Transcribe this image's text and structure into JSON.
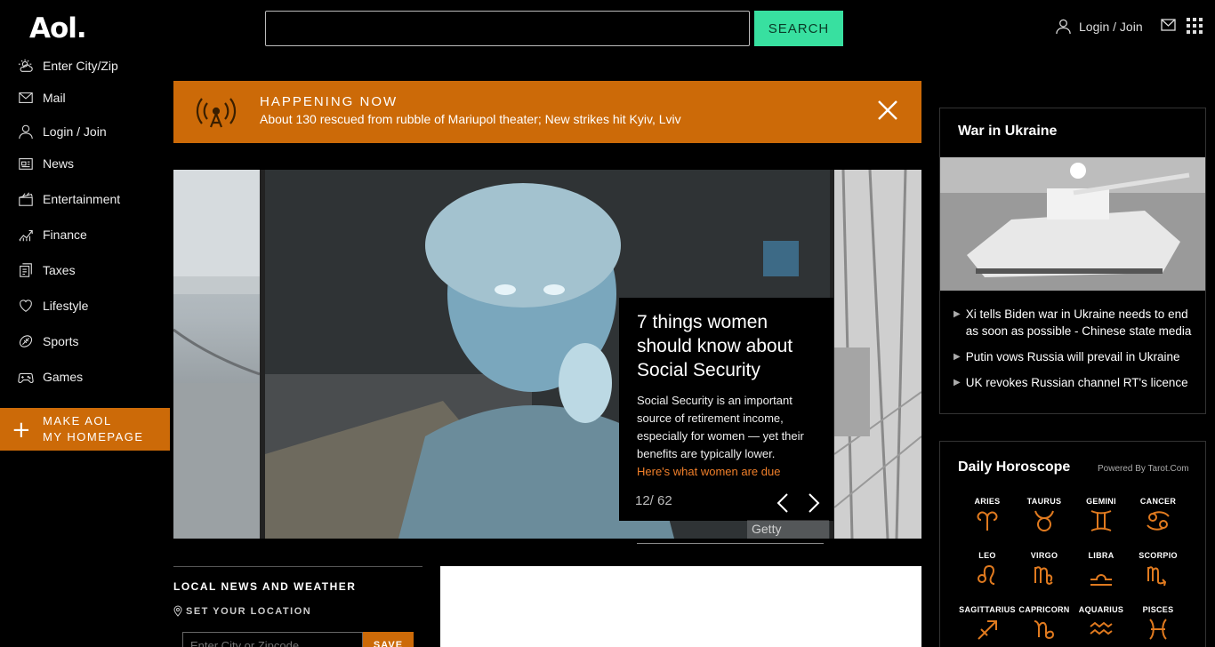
{
  "header": {
    "logo": "Aol.",
    "search_placeholder": "",
    "search_button": "SEARCH",
    "login_label": "Login / Join"
  },
  "sidebar": {
    "items": [
      {
        "label": "Enter City/Zip",
        "icon": "weather-icon"
      },
      {
        "label": "Mail",
        "icon": "mail-icon"
      },
      {
        "label": "Login / Join",
        "icon": "user-icon"
      },
      {
        "label": "News",
        "icon": "news-icon"
      },
      {
        "label": "Entertainment",
        "icon": "clapper-icon"
      },
      {
        "label": "Finance",
        "icon": "chart-icon"
      },
      {
        "label": "Taxes",
        "icon": "document-icon"
      },
      {
        "label": "Lifestyle",
        "icon": "heart-icon"
      },
      {
        "label": "Sports",
        "icon": "ball-icon"
      },
      {
        "label": "Games",
        "icon": "gamepad-icon"
      }
    ],
    "homepage_line1": "MAKE AOL",
    "homepage_line2": "MY HOMEPAGE"
  },
  "breaking": {
    "title": "HAPPENING NOW",
    "text": "About 130 rescued from rubble of Mariupol theater; New strikes hit Kyiv, Lviv"
  },
  "carousel": {
    "headline": "7 things women should know about Social Security",
    "summary": "Social Security is an important source of retirement income, especially for women — yet their benefits are typically lower.",
    "link": "Here's what women are due",
    "counter": "12/ 62",
    "credit": "Getty Images"
  },
  "local": {
    "title": "LOCAL NEWS AND WEATHER",
    "subtitle": "SET YOUR LOCATION",
    "input_placeholder": "Enter City or Zipcode",
    "save_label": "SAVE"
  },
  "ukraine": {
    "title": "War in Ukraine",
    "items": [
      "Xi tells Biden war in Ukraine needs to end as soon as possible - Chinese state media",
      "Putin vows Russia will prevail in Ukraine",
      "UK revokes Russian channel RT's licence"
    ]
  },
  "horoscope": {
    "title": "Daily Horoscope",
    "powered": "Powered By Tarot.Com",
    "signs": [
      "ARIES",
      "TAURUS",
      "GEMINI",
      "CANCER",
      "LEO",
      "VIRGO",
      "LIBRA",
      "SCORPIO",
      "SAGITTARIUS",
      "CAPRICORN",
      "AQUARIUS",
      "PISCES"
    ],
    "accent": "#e07a1f"
  },
  "colors": {
    "accent_orange": "#cc6a08",
    "search_green": "#38e0a0",
    "link_orange": "#f07f2a"
  }
}
